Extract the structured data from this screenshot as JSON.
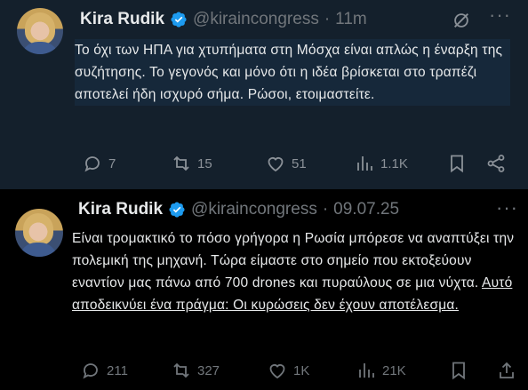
{
  "posts": [
    {
      "name": "Kira Rudik",
      "handle": "@kiraincongress",
      "separator": "·",
      "time": "11m",
      "text": "Το όχι των ΗΠΑ για χτυπήματα στη Μόσχα είναι απλώς η έναρξη της συζήτησης. Το γεγονός και μόνο ότι η ιδέα βρίσκεται στο τραπέζι αποτελεί ήδη ισχυρό σήμα. Ρώσοι, ετοιμαστείτε.",
      "link_text": "",
      "replies": "7",
      "reposts": "15",
      "likes": "51",
      "views": "1.1K"
    },
    {
      "name": "Kira Rudik",
      "handle": "@kiraincongress",
      "separator": "·",
      "time": "09.07.25",
      "text": "Είναι τρομακτικό το πόσο γρήγορα η Ρωσία μπόρεσε να αναπτύξει την πολεμική της μηχανή. Τώρα είμαστε στο σημείο που εκτοξεύουν εναντίον μας πάνω από 700 drones και πυραύλους σε μια νύχτα.",
      "link_text": "Αυτό αποδεικνύει ένα πράγμα: Οι κυρώσεις δεν έχουν αποτέλεσμα.",
      "replies": "211",
      "reposts": "327",
      "likes": "1K",
      "views": "21K"
    }
  ],
  "colors": {
    "post1_background": "#14202c",
    "post2_background": "#000000",
    "primary_text": "#e7e9ea",
    "secondary_text": "#71767b",
    "verified_badge": "#1d9bf0"
  },
  "icons": [
    "grok-icon",
    "more-icon",
    "reply-icon",
    "repost-icon",
    "like-icon",
    "views-icon",
    "bookmark-icon",
    "share-icon",
    "upload-icon",
    "verified-icon"
  ]
}
